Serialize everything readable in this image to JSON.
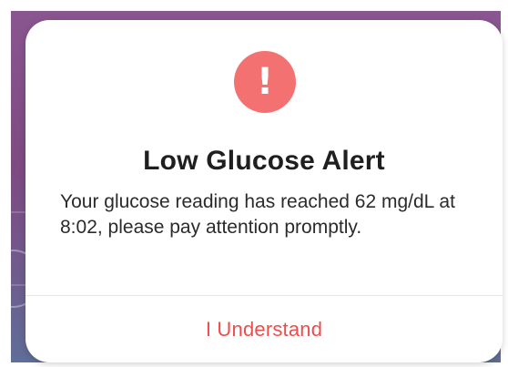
{
  "alert": {
    "icon": "exclamation-icon",
    "icon_glyph": "!",
    "icon_color": "#f47171",
    "title": "Low Glucose Alert",
    "message": "Your glucose reading has reached 62 mg/dL at 8:02, please pay attention promptly.",
    "button_label": "I Understand",
    "button_color": "#ee4d4d"
  }
}
